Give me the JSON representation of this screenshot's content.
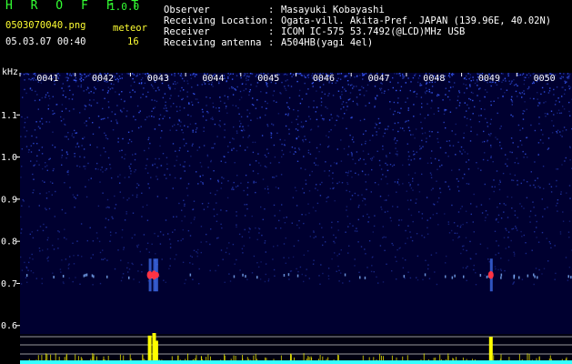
{
  "header": {
    "app_title": "H R O F F T",
    "version": "1.0.0",
    "file_name": "0503070040.png",
    "date_time": "05.03.07 00:40",
    "meteor_label": "meteor",
    "meteor_count": "16"
  },
  "info": [
    {
      "key": "Observer",
      "sep": ":",
      "value": "Masayuki Kobayashi"
    },
    {
      "key": "Receiving Location",
      "sep": ":",
      "value": "Ogata-vill. Akita-Pref. JAPAN (139.96E, 40.02N)"
    },
    {
      "key": "Receiver",
      "sep": ":",
      "value": "ICOM IC-575 53.7492(@LCD)MHz USB"
    },
    {
      "key": "Receiving antenna",
      "sep": ":",
      "value": "A504HB(yagi 4el)"
    }
  ],
  "chart_data": {
    "type": "heatmap",
    "ylabel": "kHz",
    "ylim": [
      0.58,
      1.2
    ],
    "y_ticks": [
      "1.1",
      "1.0",
      "0.9",
      "0.8",
      "0.7",
      "0.6"
    ],
    "y_tick_values": [
      1.1,
      1.0,
      0.9,
      0.8,
      0.7,
      0.6
    ],
    "time_ticks": [
      "0041",
      "0042",
      "0043",
      "0044",
      "0045",
      "0046",
      "0047",
      "0048",
      "0049",
      "0050"
    ],
    "time_range": [
      0,
      10
    ],
    "echo_band_khz": 0.72,
    "meteor_echoes": [
      {
        "t": 2.35,
        "strength": 0.9
      },
      {
        "t": 2.43,
        "strength": 1.0
      },
      {
        "t": 2.47,
        "strength": 0.7
      },
      {
        "t": 8.53,
        "strength": 0.85
      }
    ],
    "colors": {
      "background": "#000030",
      "noise": "#3a5cff",
      "echo": "#ff3344",
      "meter": "#ffff00",
      "baseline": "#33ffff"
    }
  }
}
